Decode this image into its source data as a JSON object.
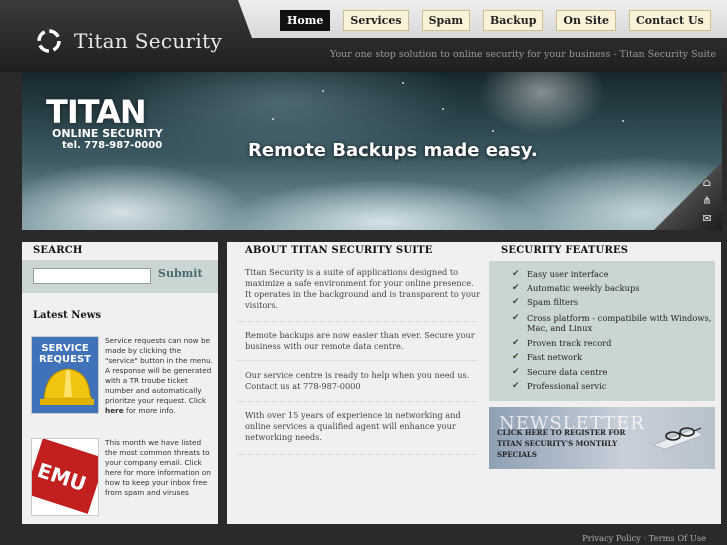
{
  "site": {
    "logo_text": "Titan Security",
    "tagline": "Your one stop solution to online security for your business - Titan Security Suite"
  },
  "nav": {
    "items": [
      {
        "label": "Home",
        "active": true
      },
      {
        "label": "Services",
        "active": false
      },
      {
        "label": "Spam",
        "active": false
      },
      {
        "label": "Backup",
        "active": false
      },
      {
        "label": "On Site",
        "active": false
      },
      {
        "label": "Contact Us",
        "active": false
      }
    ]
  },
  "banner": {
    "brand_title": "TITAN",
    "brand_subtitle": "ONLINE SECURITY",
    "brand_phone": "tel. 778-987-0000",
    "headline": "Remote Backups made easy.",
    "curl_icons": [
      "home-icon",
      "sitemap-icon",
      "contact-icon"
    ]
  },
  "search": {
    "heading": "SEARCH",
    "input_value": "",
    "button_label": "Submit"
  },
  "news": {
    "heading": "Latest News",
    "items": [
      {
        "thumb_label_line1": "SERVICE",
        "thumb_label_line2": "REQUEST",
        "text_before": "Service requests can now be made by clicking the \"service\" button in the menu. A response will be generated with a TR troube ticket number and automatically prioritze your request. Click ",
        "text_link": "here",
        "text_after": " for more info."
      },
      {
        "thumb_label_line1": "EMU",
        "text": "This month we have listed the most common threats to your company email. Click here for more information on how to keep your inbox free from spam and viruses"
      }
    ]
  },
  "about": {
    "heading": "ABOUT TITAN SECURITY SUITE",
    "paragraphs": [
      "Titan Security is a suite of applications designed to maximize a safe environment for your online presence. It operates in the background and is transparent to your visitors.",
      "Remote backups are now easier than ever. Secure your business with our remote data centre.",
      "Our service centre is ready to help when you need us. Contact us at 778-987-0000",
      "With over 15 years of experience in networking and online services a qualified agent will enhance your networking needs."
    ]
  },
  "features": {
    "heading": "SECURITY FEATURES",
    "items": [
      "Easy user interface",
      "Automatic weekly backups",
      "Spam filters",
      "Cross platform - compatibile with Windows, Mac, and Linux",
      "Proven track record",
      "Fast network",
      "Secure data centre",
      "Professional servic"
    ]
  },
  "newsletter": {
    "title": "NEWSLETTER",
    "cta": "CLICK HERE TO REGISTER FOR TITAN SECURITY'S MONTHLY SPECIALS"
  },
  "footer": {
    "privacy": "Privacy Policy",
    "separator": " · ",
    "terms": "Terms Of Use"
  }
}
